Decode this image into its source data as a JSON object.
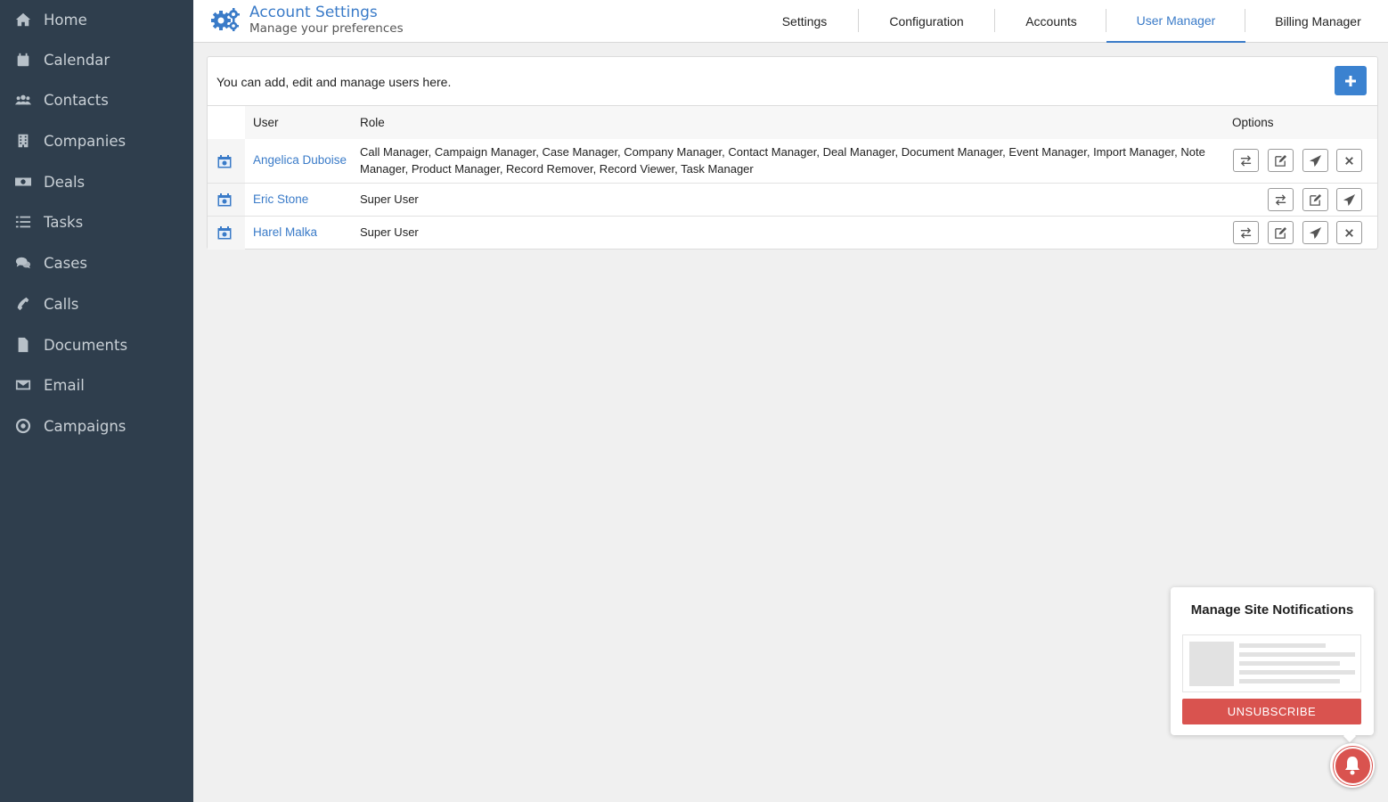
{
  "sidebar": {
    "items": [
      {
        "label": "Home",
        "icon": "home-icon"
      },
      {
        "label": "Calendar",
        "icon": "calendar-icon"
      },
      {
        "label": "Contacts",
        "icon": "contacts-icon"
      },
      {
        "label": "Companies",
        "icon": "building-icon"
      },
      {
        "label": "Deals",
        "icon": "money-icon"
      },
      {
        "label": "Tasks",
        "icon": "tasks-icon"
      },
      {
        "label": "Cases",
        "icon": "chat-bubbles-icon"
      },
      {
        "label": "Calls",
        "icon": "phone-icon"
      },
      {
        "label": "Documents",
        "icon": "document-icon"
      },
      {
        "label": "Email",
        "icon": "envelope-icon"
      },
      {
        "label": "Campaigns",
        "icon": "target-icon"
      }
    ]
  },
  "header": {
    "title": "Account Settings",
    "subtitle": "Manage your preferences",
    "icon": "gears-icon",
    "tabs": [
      {
        "label": "Settings",
        "active": false
      },
      {
        "label": "Configuration",
        "active": false
      },
      {
        "label": "Accounts",
        "active": false
      },
      {
        "label": "User Manager",
        "active": true
      },
      {
        "label": "Billing Manager",
        "active": false
      }
    ]
  },
  "panel": {
    "intro": "You can add, edit and manage users here.",
    "add_icon": "plus-icon",
    "columns": {
      "user": "User",
      "role": "Role",
      "options": "Options"
    },
    "rows": [
      {
        "user": "Angelica Duboise",
        "role": "Call Manager, Campaign Manager, Case Manager, Company Manager, Contact Manager, Deal Manager, Document Manager, Event Manager, Import Manager, Note Manager, Product Manager, Record Remover, Record Viewer, Task Manager",
        "options": [
          "transfer",
          "edit",
          "send",
          "delete"
        ]
      },
      {
        "user": "Eric Stone",
        "role": "Super User",
        "options": [
          "transfer",
          "edit",
          "send"
        ]
      },
      {
        "user": "Harel Malka",
        "role": "Super User",
        "options": [
          "transfer",
          "edit",
          "send",
          "delete"
        ]
      }
    ]
  },
  "notification": {
    "title": "Manage Site Notifications",
    "button": "UNSUBSCRIBE",
    "bell_icon": "bell-icon"
  },
  "colors": {
    "sidebar_bg": "#2f3e4d",
    "accent": "#3a7bc8",
    "danger": "#d9534f"
  }
}
